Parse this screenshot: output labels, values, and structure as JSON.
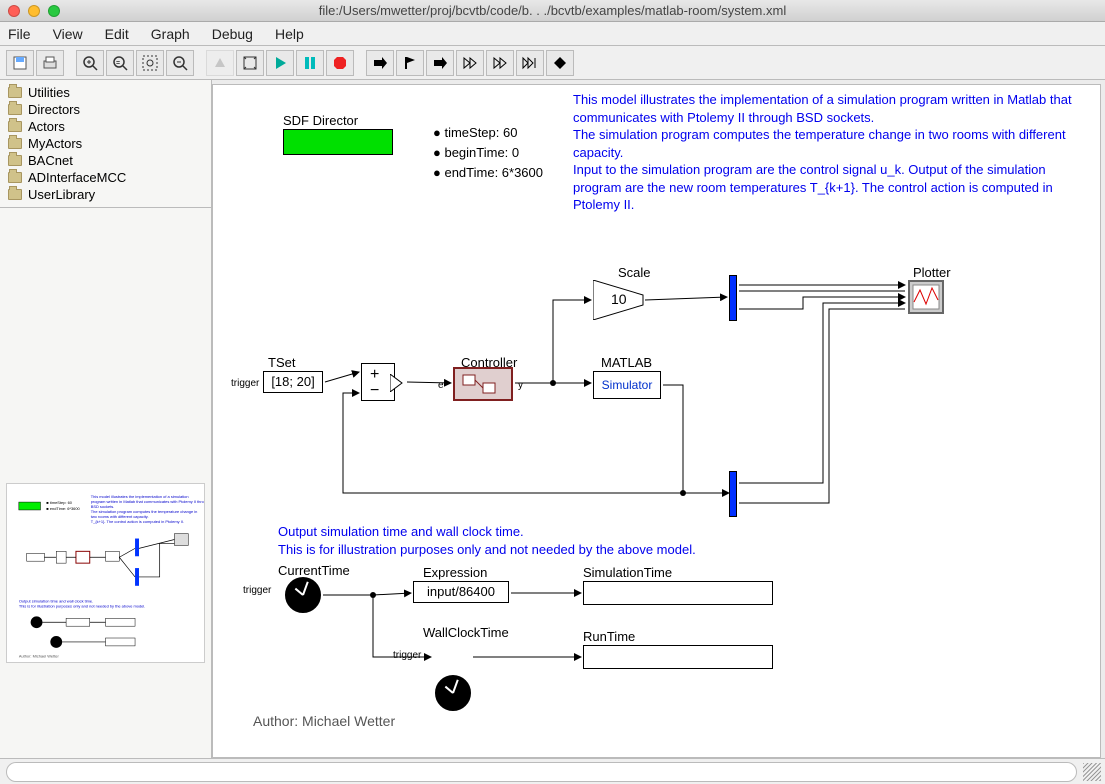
{
  "window": {
    "title": "file:/Users/mwetter/proj/bcvtb/code/b. . ./bcvtb/examples/matlab-room/system.xml"
  },
  "menu": {
    "file": "File",
    "view": "View",
    "edit": "Edit",
    "graph": "Graph",
    "debug": "Debug",
    "help": "Help"
  },
  "sidebar": {
    "items": [
      {
        "label": "Utilities"
      },
      {
        "label": "Directors"
      },
      {
        "label": "Actors"
      },
      {
        "label": "MyActors"
      },
      {
        "label": "BACnet"
      },
      {
        "label": "ADInterfaceMCC"
      },
      {
        "label": "UserLibrary"
      }
    ]
  },
  "director": {
    "title": "SDF Director",
    "params": [
      "timeStep: 60",
      "beginTime: 0",
      "endTime: 6*3600"
    ]
  },
  "description": "This model illustrates the implementation of a simulation program written in Matlab that communicates with Ptolemy II through BSD sockets.\nThe simulation program computes the temperature change in two rooms with different capacity.\nInput to the simulation program are the control signal u_k. Output of the simulation program are the new room temperatures T_{k+1}. The control action is computed in Ptolemy II.",
  "blocks": {
    "tset": {
      "label": "TSet",
      "value": "[18; 20]",
      "trigger": "trigger"
    },
    "adder": {
      "plus": "+",
      "minus": "−"
    },
    "controller": {
      "label": "Controller",
      "e": "e",
      "y": "y"
    },
    "scale": {
      "label": "Scale",
      "value": "10"
    },
    "matlab": {
      "label": "MATLAB",
      "sub": "Simulator"
    },
    "plotter": {
      "label": "Plotter"
    },
    "note2": "Output simulation time and wall clock time.\nThis is for illustration purposes only and not needed by the above model.",
    "currenttime": {
      "label": "CurrentTime",
      "trigger": "trigger"
    },
    "expression": {
      "label": "Expression",
      "value": "input/86400"
    },
    "simulationtime": {
      "label": "SimulationTime"
    },
    "wallclock": {
      "label": "WallClockTime",
      "trigger": "trigger"
    },
    "runtime": {
      "label": "RunTime"
    }
  },
  "author": "Author: Michael Wetter"
}
